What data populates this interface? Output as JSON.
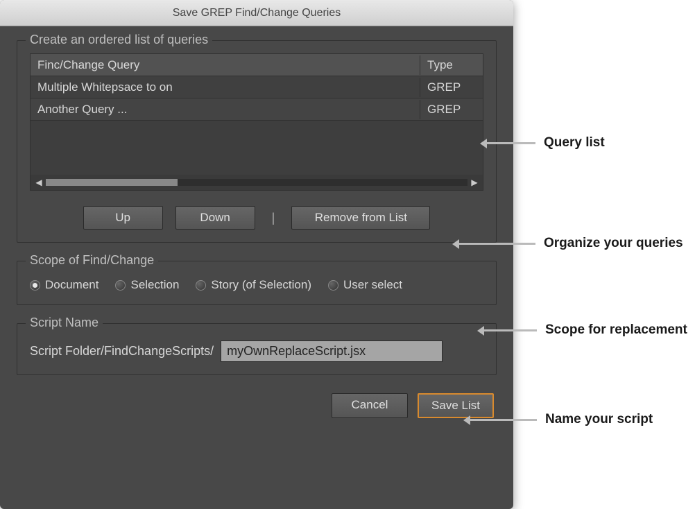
{
  "dialog": {
    "title": "Save GREP Find/Change Queries"
  },
  "fieldset_queries": {
    "legend": "Create an ordered list of queries",
    "columns": {
      "query": "Finc/Change Query",
      "type": "Type"
    },
    "rows": [
      {
        "query": "Multiple Whitepsace to on",
        "type": "GREP"
      },
      {
        "query": "Another Query ...",
        "type": "GREP"
      }
    ],
    "buttons": {
      "up": "Up",
      "down": "Down",
      "remove": "Remove from List"
    }
  },
  "fieldset_scope": {
    "legend": "Scope of Find/Change",
    "options": [
      {
        "label": "Document",
        "selected": true
      },
      {
        "label": "Selection",
        "selected": false
      },
      {
        "label": "Story (of Selection)",
        "selected": false
      },
      {
        "label": "User select",
        "selected": false
      }
    ]
  },
  "fieldset_script": {
    "legend": "Script Name",
    "path_label": "Script Folder/FindChangeScripts/",
    "filename": "myOwnReplaceScript.jsx"
  },
  "actions": {
    "cancel": "Cancel",
    "save": "Save List"
  },
  "annotations": {
    "query_list": "Query list",
    "organize": "Organize your queries",
    "scope": "Scope for replacement",
    "name_script": "Name your script"
  }
}
